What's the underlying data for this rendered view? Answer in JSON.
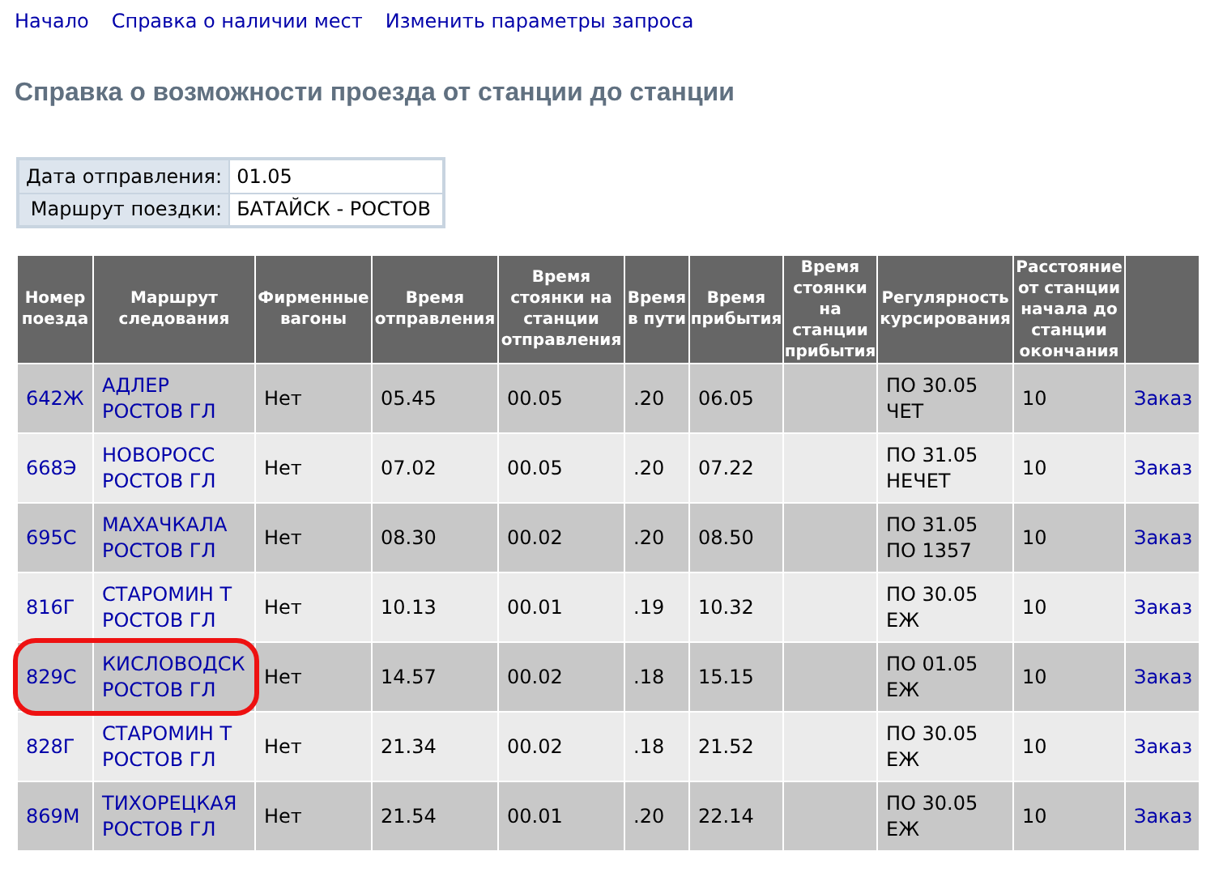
{
  "nav_links": [
    "Начало",
    "Справка о наличии мест",
    "Изменить параметры запроса"
  ],
  "title": "Справка о возможности проезда от станции до станции",
  "info": [
    {
      "label": "Дата отправления:",
      "value": "01.05"
    },
    {
      "label": "Маршрут поездки:",
      "value": "БАТАЙСК - РОСТОВ"
    }
  ],
  "table": {
    "columns": [
      "Номер поезда",
      "Маршрут следования",
      "Фирменные вагоны",
      "Время отправления",
      "Время стоянки на станции отправления",
      "Время в пути",
      "Время прибытия",
      "Время стоянки на станции прибытия",
      "Регулярность курсирования",
      "Расстояние от станции начала до станции окончания"
    ],
    "rows": [
      {
        "train": "642Ж",
        "route": [
          "АДЛЕР",
          "РОСТОВ ГЛ"
        ],
        "branded": "Нет",
        "departure": "05.45",
        "dep_stop": "00.05",
        "travel": ".20",
        "arrival": "06.05",
        "regularity": [
          "ПО 30.05",
          "ЧЕТ"
        ],
        "distance": "10",
        "order": "Заказ",
        "circled": false
      },
      {
        "train": "668Э",
        "route": [
          "НОВОРОСС",
          "РОСТОВ ГЛ"
        ],
        "branded": "Нет",
        "departure": "07.02",
        "dep_stop": "00.05",
        "travel": ".20",
        "arrival": "07.22",
        "regularity": [
          "ПО 31.05",
          "НЕЧЕТ"
        ],
        "distance": "10",
        "order": "Заказ",
        "circled": false
      },
      {
        "train": "695С",
        "route": [
          "МАХАЧКАЛА",
          "РОСТОВ ГЛ"
        ],
        "branded": "Нет",
        "departure": "08.30",
        "dep_stop": "00.02",
        "travel": ".20",
        "arrival": "08.50",
        "regularity": [
          "ПО 31.05",
          "ПО 1357"
        ],
        "distance": "10",
        "order": "Заказ",
        "circled": false
      },
      {
        "train": "816Г",
        "route": [
          "СТАРОМИН Т",
          "РОСТОВ ГЛ"
        ],
        "branded": "Нет",
        "departure": "10.13",
        "dep_stop": "00.01",
        "travel": ".19",
        "arrival": "10.32",
        "regularity": [
          "ПО 30.05",
          "ЕЖ"
        ],
        "distance": "10",
        "order": "Заказ",
        "circled": false
      },
      {
        "train": "829С",
        "route": [
          "КИСЛОВОДСК",
          "РОСТОВ ГЛ"
        ],
        "branded": "Нет",
        "departure": "14.57",
        "dep_stop": "00.02",
        "travel": ".18",
        "arrival": "15.15",
        "regularity": [
          "ПО 01.05",
          "ЕЖ"
        ],
        "distance": "10",
        "order": "Заказ",
        "circled": true
      },
      {
        "train": "828Г",
        "route": [
          "СТАРОМИН Т",
          "РОСТОВ ГЛ"
        ],
        "branded": "Нет",
        "departure": "21.34",
        "dep_stop": "00.02",
        "travel": ".18",
        "arrival": "21.52",
        "regularity": [
          "ПО 30.05",
          "ЕЖ"
        ],
        "distance": "10",
        "order": "Заказ",
        "circled": false
      },
      {
        "train": "869М",
        "route": [
          "ТИХОРЕЦКАЯ",
          "РОСТОВ ГЛ"
        ],
        "branded": "Нет",
        "departure": "21.54",
        "dep_stop": "00.01",
        "travel": ".20",
        "arrival": "22.14",
        "regularity": [
          "ПО 30.05",
          "ЕЖ"
        ],
        "distance": "10",
        "order": "Заказ",
        "circled": false
      }
    ]
  }
}
